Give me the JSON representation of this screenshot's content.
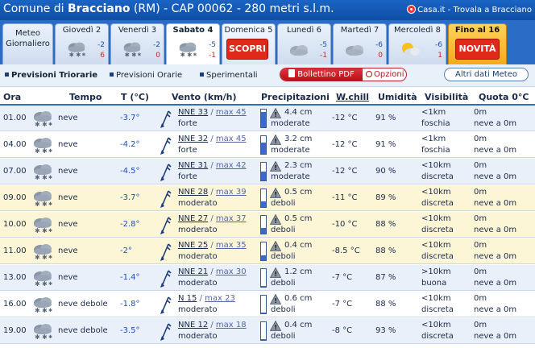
{
  "header": {
    "title_prefix": "Comune di ",
    "town": "Bracciano",
    "title_suffix": " (RM)  -  CAP 00062  -  280 metri s.l.m.",
    "brand": "Casa.it - Trovala a Bracciano"
  },
  "tabs": [
    {
      "label": "Meteo\nGiornaliero",
      "kind": "meteo"
    },
    {
      "label": "Giovedì 2",
      "max": "-2",
      "min": "6",
      "icon": "snow-cloud-icon"
    },
    {
      "label": "Venerdì 3",
      "max": "-2",
      "min": "0",
      "icon": "snow-cloud-icon"
    },
    {
      "label": "Sabato 4",
      "max": "-5",
      "min": "-1",
      "icon": "snow-cloud-icon",
      "active": true
    },
    {
      "label": "Domenica 5",
      "button": "SCOPRI",
      "kind": "promo"
    },
    {
      "label": "Lunedì 6",
      "max": "-5",
      "min": "-1",
      "icon": "cloud-icon"
    },
    {
      "label": "Martedì 7",
      "max": "-6",
      "min": "0",
      "icon": "cloud-icon"
    },
    {
      "label": "Mercoledì 8",
      "max": "-6",
      "min": "1",
      "icon": "sun-cloud-icon"
    },
    {
      "label": "Fino al 16",
      "button": "NOVITÀ",
      "kind": "novita"
    }
  ],
  "subnav": {
    "triorarie": "Previsioni Triorarie",
    "orarie": "Previsioni Orarie",
    "sperimentali": "Sperimentali",
    "bollettino": "Bollettino PDF",
    "opzioni": "Opzioni",
    "altri": "Altri dati Meteo"
  },
  "columns": {
    "ora": "Ora",
    "tempo": "Tempo",
    "temp": "T (°C)",
    "vento": "Vento (km/h)",
    "prec": "Precipitazioni",
    "chill": "W.chill",
    "umid": "Umidità",
    "vis": "Visibilità",
    "quota": "Quota 0°C"
  },
  "colors": {
    "topbar": "#1a64c4",
    "row_blue": "#e9f0fa",
    "row_yellow": "#fdf6d6",
    "temp_text": "#1c4eb8",
    "rain_fill": "#3a68d0",
    "warning": "#f2c01e"
  },
  "rows": [
    {
      "ora": "01.00",
      "tempo": "neve",
      "temp": "-3.7°",
      "dir": "NNE 33",
      "sep": " / ",
      "max": "max 45",
      "forza": "forte",
      "prec": "4.4 cm",
      "intens": "moderate",
      "fill": 0.85,
      "chill": "-12 °C",
      "umid": "91 %",
      "vis": "<1km",
      "vis2": "foschia",
      "q1": "0m",
      "q2": "neve a 0m",
      "bg": "blue"
    },
    {
      "ora": "04.00",
      "tempo": "neve",
      "temp": "-4.2°",
      "dir": "NNE 32",
      "sep": " / ",
      "max": "max 45",
      "forza": "forte",
      "prec": "3.2 cm",
      "intens": "moderate",
      "fill": 0.65,
      "chill": "-12 °C",
      "umid": "91 %",
      "vis": "<1km",
      "vis2": "foschia",
      "q1": "0m",
      "q2": "neve a 0m",
      "bg": "white"
    },
    {
      "ora": "07.00",
      "tempo": "neve",
      "temp": "-4.5°",
      "dir": "NNE 31",
      "sep": " / ",
      "max": "max 42",
      "forza": "forte",
      "prec": "2.3 cm",
      "intens": "moderate",
      "fill": 0.5,
      "chill": "-12 °C",
      "umid": "90 %",
      "vis": "<10km",
      "vis2": "discreta",
      "q1": "0m",
      "q2": "neve a 0m",
      "bg": "blue"
    },
    {
      "ora": "09.00",
      "tempo": "neve",
      "temp": "-3.7°",
      "dir": "NNE 28",
      "sep": " / ",
      "max": "max 39",
      "forza": "moderato",
      "prec": "0.5 cm",
      "intens": "deboli",
      "fill": 0.3,
      "chill": "-11 °C",
      "umid": "89 %",
      "vis": "<10km",
      "vis2": "discreta",
      "q1": "0m",
      "q2": "neve a 0m",
      "bg": "yellow"
    },
    {
      "ora": "10.00",
      "tempo": "neve",
      "temp": "-2.8°",
      "dir": "NNE 27",
      "sep": " / ",
      "max": "max 37",
      "forza": "moderato",
      "prec": "0.5 cm",
      "intens": "deboli",
      "fill": 0.3,
      "chill": "-10 °C",
      "umid": "88 %",
      "vis": "<10km",
      "vis2": "discreta",
      "q1": "0m",
      "q2": "neve a 0m",
      "bg": "yellow"
    },
    {
      "ora": "11.00",
      "tempo": "neve",
      "temp": "-2°",
      "dir": "NNE 25",
      "sep": " / ",
      "max": "max 35",
      "forza": "moderato",
      "prec": "0.4 cm",
      "intens": "deboli",
      "fill": 0.28,
      "chill": "-8.5 °C",
      "umid": "88 %",
      "vis": "<10km",
      "vis2": "discreta",
      "q1": "0m",
      "q2": "neve a 0m",
      "bg": "yellow"
    },
    {
      "ora": "13.00",
      "tempo": "neve",
      "temp": "-1.4°",
      "dir": "NNE 21",
      "sep": " / ",
      "max": "max 30",
      "forza": "moderato",
      "prec": "1.2 cm",
      "intens": "deboli",
      "fill": 0.05,
      "chill": "-7 °C",
      "umid": "87 %",
      "vis": ">10km",
      "vis2": "buona",
      "q1": "0m",
      "q2": "neve a 0m",
      "bg": "blue"
    },
    {
      "ora": "16.00",
      "tempo": "neve debole",
      "temp": "-1.8°",
      "dir": "N 15",
      "sep": " / ",
      "max": "max 23",
      "forza": "moderato",
      "prec": "0.6 cm",
      "intens": "deboli",
      "fill": 0.05,
      "chill": "-7 °C",
      "umid": "88 %",
      "vis": "<10km",
      "vis2": "discreta",
      "q1": "0m",
      "q2": "neve a 0m",
      "bg": "white"
    },
    {
      "ora": "19.00",
      "tempo": "neve debole",
      "temp": "-3.5°",
      "dir": "NNE 12",
      "sep": " / ",
      "max": "max 18",
      "forza": "moderato",
      "prec": "0.4 cm",
      "intens": "deboli",
      "fill": 0.05,
      "chill": "-8 °C",
      "umid": "93 %",
      "vis": "<10km",
      "vis2": "discreta",
      "q1": "0m",
      "q2": "neve a 0m",
      "bg": "blue"
    }
  ]
}
